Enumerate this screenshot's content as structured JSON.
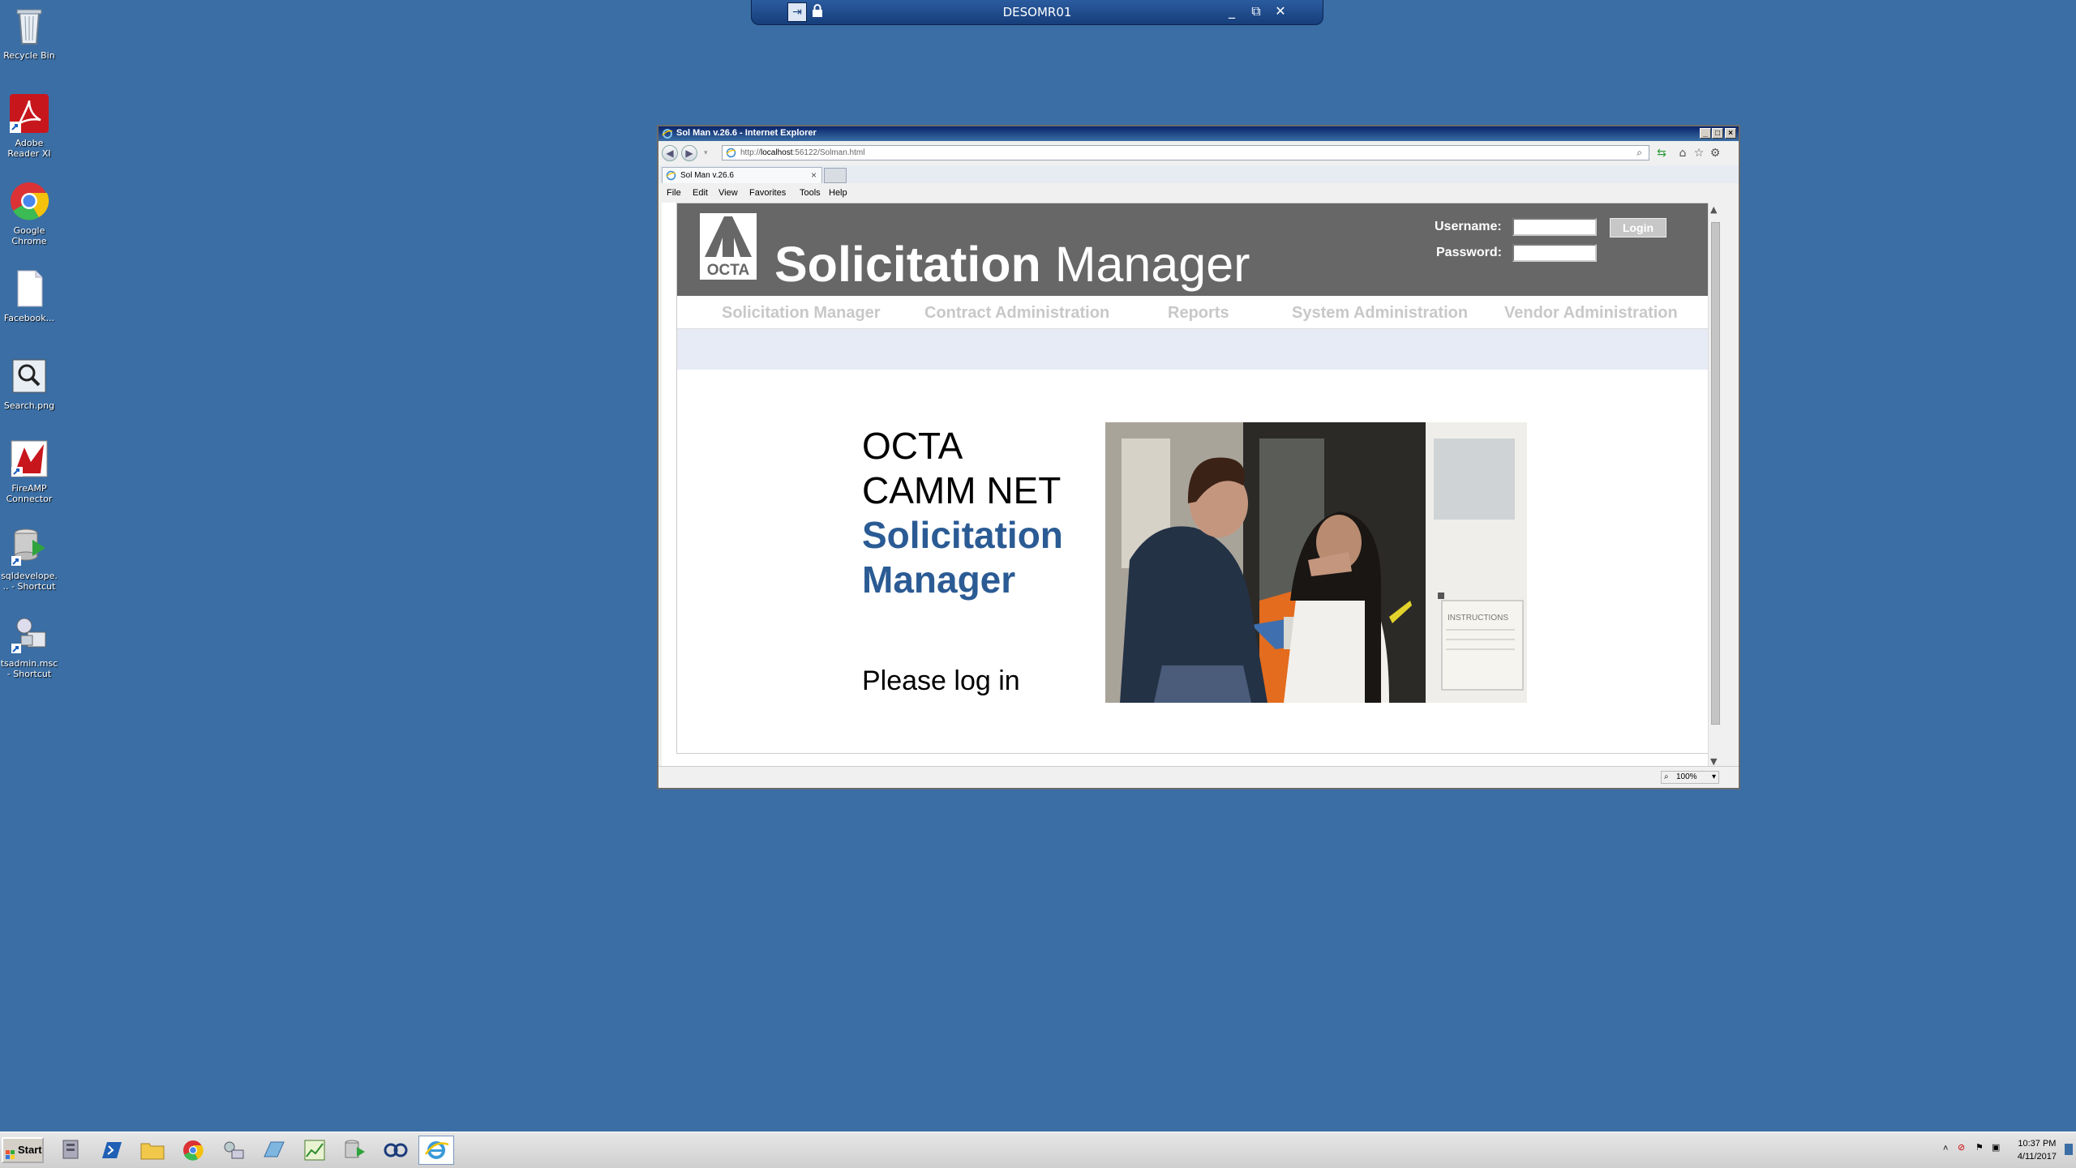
{
  "rdp": {
    "title": "DESOMR01",
    "minimize": "_",
    "restore": "⧉",
    "close": "✕"
  },
  "desktop": {
    "icons": [
      {
        "label": "Recycle Bin"
      },
      {
        "label": "Adobe Reader XI"
      },
      {
        "label": "Google Chrome"
      },
      {
        "label": "Facebook..."
      },
      {
        "label": "Search.png"
      },
      {
        "label": "FireAMP Connector"
      },
      {
        "label": "sqldevelope... - Shortcut"
      },
      {
        "label": "tsadmin.msc - Shortcut"
      }
    ]
  },
  "browser": {
    "window_title": "Sol Man v.26.6 - Internet Explorer",
    "url_prefix": "http://",
    "url_host": "localhost",
    "url_rest": ":56122/Solman.html",
    "tab_title": "Sol Man v.26.6",
    "tab_close": "×",
    "menu": [
      "File",
      "Edit",
      "View",
      "Favorites",
      "Tools",
      "Help"
    ],
    "zoom": "100%",
    "icons": [
      "back-icon",
      "forward-icon",
      "search-icon",
      "refresh-icon",
      "home-icon",
      "favorites-star-icon",
      "gear-icon"
    ]
  },
  "page": {
    "logo_text": "OCTA",
    "app_title_bold": "Solicitation",
    "app_title_rest": " Manager",
    "username_label": "Username:",
    "password_label": "Password:",
    "login_button": "Login",
    "nav": [
      "Solicitation Manager",
      "Contract Administration",
      "Reports",
      "System Administration",
      "Vendor Administration"
    ],
    "welcome_line1": "OCTA",
    "welcome_line2": "CAMM NET",
    "welcome_line3": "Solicitation",
    "welcome_line4": "Manager",
    "please_login": "Please log in",
    "photo_text": "INSTRUCTIONS"
  },
  "taskbar": {
    "start": "Start",
    "time": "10:37 PM",
    "date": "4/11/2017"
  },
  "colors": {
    "desktop": "#3a6ea5",
    "header": "#676767",
    "title_blue": "#2b5b94",
    "nav_text": "#c8c8c8",
    "subband": "#e7ebf5"
  }
}
